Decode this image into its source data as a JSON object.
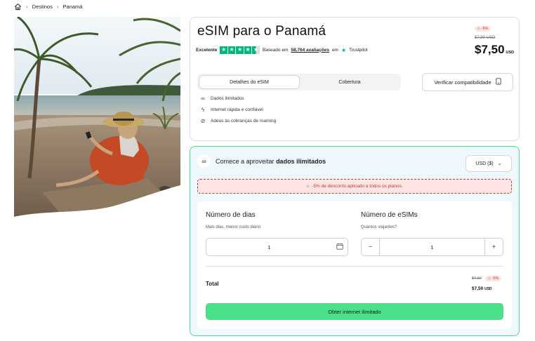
{
  "breadcrumb": {
    "home_icon": "home-icon",
    "items": [
      "Destinos",
      "Panamá"
    ]
  },
  "product": {
    "title": "eSIM para o Panamá",
    "rating_word": "Excelente",
    "rating_stars": 4.5,
    "based_on": "Baseado em",
    "reviews_count": "58.764 avaliações",
    "reviews_suffix": "em",
    "trustpilot": "Trustpilot",
    "discount_badge": "-5%",
    "old_price": "$7,90 USD",
    "price": "$7,50",
    "price_currency": "USD"
  },
  "tabs": [
    {
      "label": "Detalhes do eSIM",
      "active": true
    },
    {
      "label": "Cobertura",
      "active": false
    }
  ],
  "verify_button": "Verificar compatibilidade",
  "features": [
    {
      "icon": "infinity-icon",
      "text": "Dados ilimitados"
    },
    {
      "icon": "lightning-icon",
      "text": "Internet rápida e confiável"
    },
    {
      "icon": "no-roaming-icon",
      "text": "Adeus às cobranças de roaming"
    }
  ],
  "plan": {
    "header_prefix": "Comece a aproveitar",
    "header_bold": "dados ilimitados",
    "currency": "USD ($)",
    "discount_banner": "-5% de desconto aplicado a todos os planos.",
    "days_label": "Número de dias",
    "days_sub": "Mais dias, menor custo diário",
    "days_value": "1",
    "esims_label": "Número de eSIMs",
    "esims_sub": "Quantos viajantes?",
    "esims_value": "1",
    "minus": "−",
    "plus": "+",
    "total_label": "Total",
    "total_old": "$7,90",
    "total_badge": "-5%",
    "total_price": "$7,50",
    "total_currency": "USD",
    "cta": "Obter internet ilimitado"
  },
  "colors": {
    "accent_green": "#4ae08a",
    "border_green": "#4cdb8f",
    "discount_red": "#c0392b",
    "trustpilot_green": "#00b67a"
  }
}
